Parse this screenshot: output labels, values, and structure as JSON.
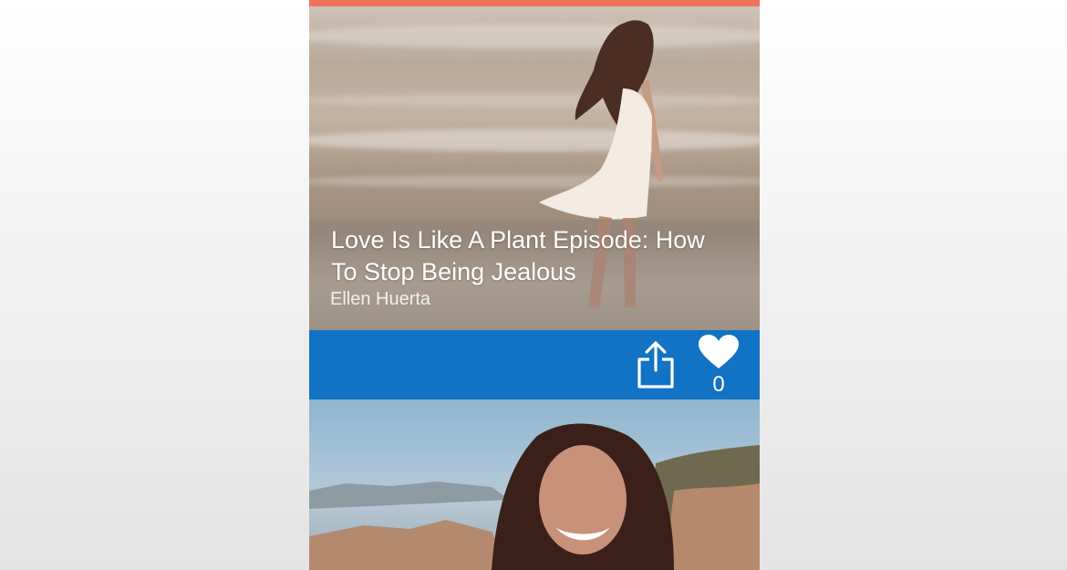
{
  "colors": {
    "top_bar": "#f0725d",
    "action_bar": "#1272c4",
    "icon": "#ffffff"
  },
  "card1": {
    "title": "Love Is Like A Plant Episode: How To Stop Being Jealous",
    "author": "Ellen Huerta",
    "likes": "0",
    "icons": {
      "share": "share-icon",
      "like": "heart-icon"
    }
  }
}
